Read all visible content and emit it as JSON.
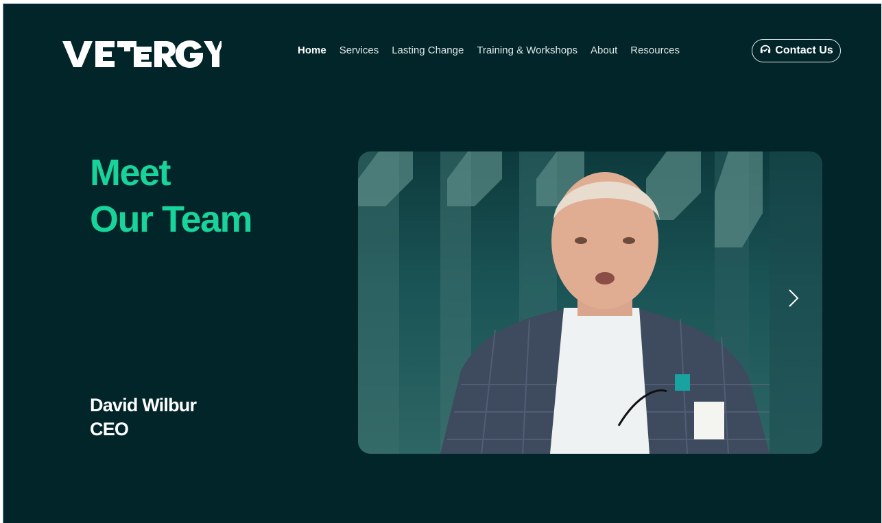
{
  "header": {
    "logo_text": "VETERGY",
    "nav": [
      "Home",
      "Services",
      "Lasting Change",
      "Training & Workshops",
      "About",
      "Resources"
    ],
    "active_nav": "Home",
    "contact_label": "Contact Us"
  },
  "hero": {
    "headline_line1": "Meet",
    "headline_line2": "Our Team",
    "person_name": "David Wilbur",
    "person_title": "CEO",
    "photo_alt": "Photo of David Wilbur speaking at an event"
  },
  "icons": {
    "contact": "headset-icon",
    "next": "chevron-right-icon"
  },
  "colors": {
    "background": "#02252a",
    "accent": "#19d49a",
    "text": "#ffffff"
  }
}
